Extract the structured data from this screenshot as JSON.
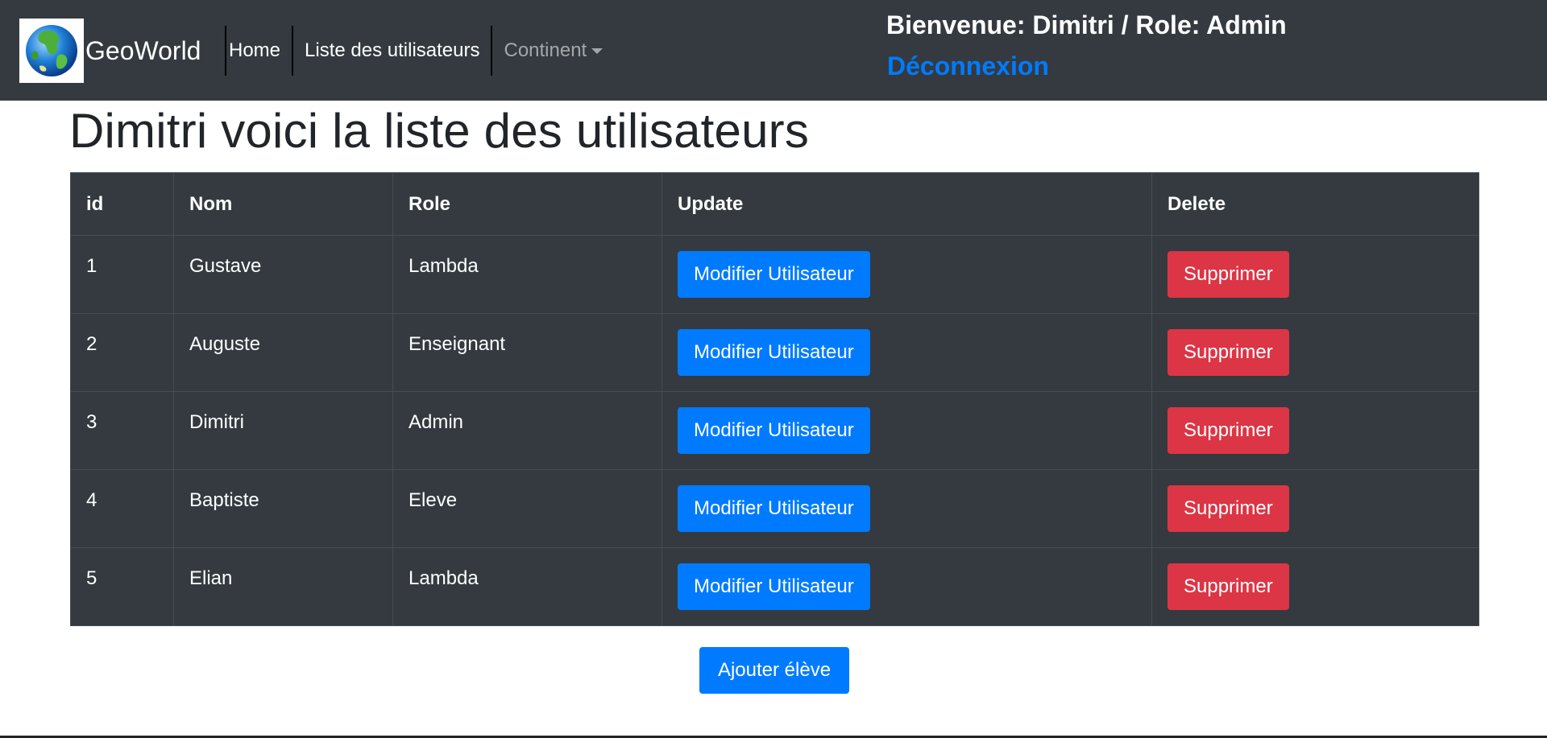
{
  "navbar": {
    "brand": "GeoWorld",
    "links": [
      {
        "label": "Home"
      },
      {
        "label": "Liste des utilisateurs"
      },
      {
        "label": "Continent"
      }
    ],
    "welcome": "Bienvenue: Dimitri / Role: Admin",
    "logout": "Déconnexion"
  },
  "page": {
    "title": "Dimitri voici la liste des utilisateurs",
    "add_button": "Ajouter élève"
  },
  "table": {
    "headers": [
      "id",
      "Nom",
      "Role",
      "Update",
      "Delete"
    ],
    "update_label": "Modifier Utilisateur",
    "delete_label": "Supprimer",
    "rows": [
      {
        "id": "1",
        "nom": "Gustave",
        "role": "Lambda"
      },
      {
        "id": "2",
        "nom": "Auguste",
        "role": "Enseignant"
      },
      {
        "id": "3",
        "nom": "Dimitri",
        "role": "Admin"
      },
      {
        "id": "4",
        "nom": "Baptiste",
        "role": "Eleve"
      },
      {
        "id": "5",
        "nom": "Elian",
        "role": "Lambda"
      }
    ]
  },
  "icons": {
    "logo": "globe-icon",
    "dropdown": "caret-down-icon"
  },
  "colors": {
    "navbar": "#343a40",
    "primary": "#007bff",
    "danger": "#dc3545",
    "table_bg": "#343a40"
  }
}
